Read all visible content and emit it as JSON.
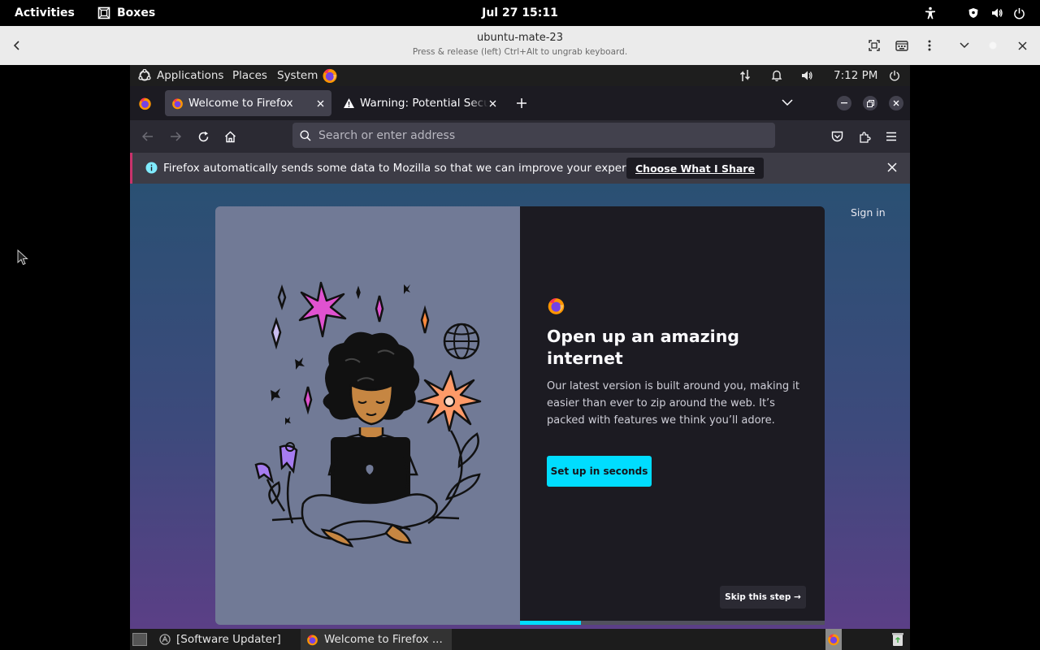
{
  "gnome_topbar": {
    "activities": "Activities",
    "app_name": "Boxes",
    "clock": "Jul 27  15:11"
  },
  "boxes_header": {
    "title": "ubuntu-mate-23",
    "subtitle": "Press & release (left) Ctrl+Alt to ungrab keyboard."
  },
  "mate_panel": {
    "applications": "Applications",
    "places": "Places",
    "system": "System",
    "clock": "7:12 PM"
  },
  "firefox": {
    "tabs": [
      {
        "label": "Welcome to Firefox",
        "active": true
      },
      {
        "label": "Warning: Potential Securi",
        "active": false
      }
    ],
    "url_placeholder": "Search or enter address",
    "notification": {
      "message": "Firefox automatically sends some data to Mozilla so that we can improve your experience.",
      "button": "Choose What I Share"
    }
  },
  "welcome_page": {
    "sign_in": "Sign in",
    "heading": "Open up an amazing internet",
    "body": "Our latest version is built around you, making it easier than ever to zip around the web. It’s packed with features we think you’ll adore.",
    "cta": "Set up in seconds",
    "skip": "Skip this step →",
    "progress_fraction": 0.2,
    "colors": {
      "accent": "#00ddff",
      "card_dark": "#1c1b22",
      "card_illustration": "#717a96"
    }
  },
  "taskbar": {
    "items": [
      {
        "label": "[Software Updater]",
        "icon": "software-updater-icon"
      },
      {
        "label": "Welcome to Firefox ...",
        "icon": "firefox-icon"
      }
    ]
  }
}
